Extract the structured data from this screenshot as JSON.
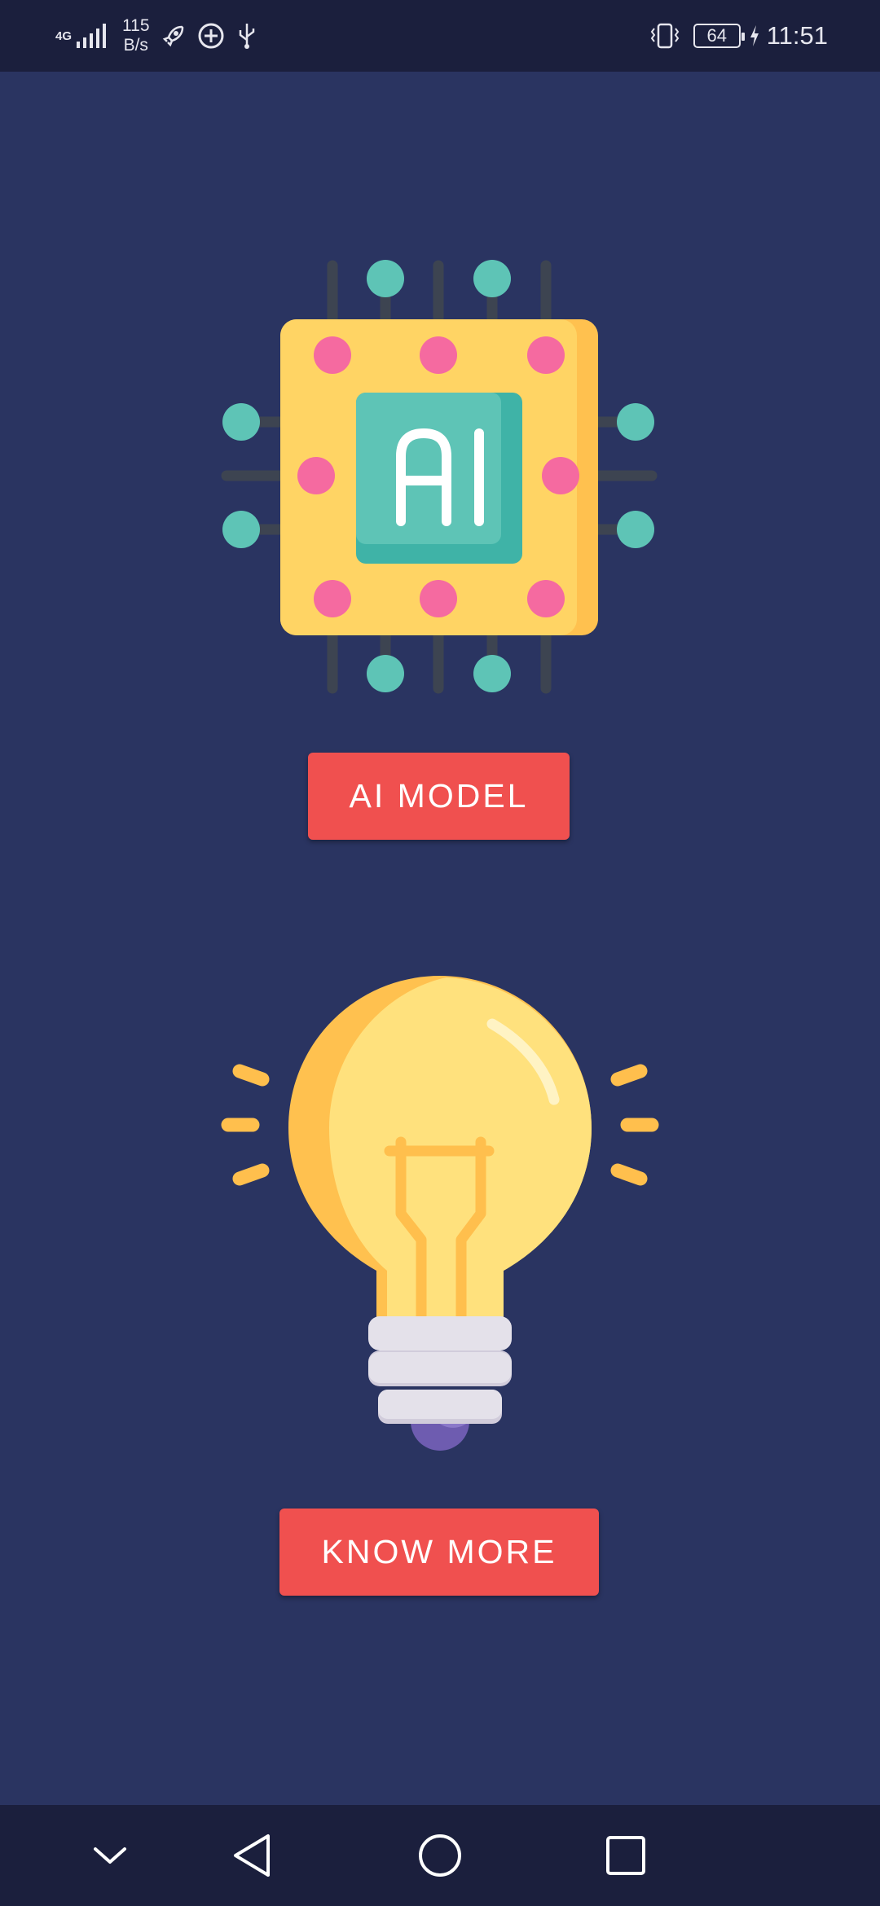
{
  "status_bar": {
    "network_type": "4G",
    "speed_value": "115",
    "speed_unit": "B/s",
    "icons": [
      "signal-icon",
      "rocket-icon",
      "add-circle-icon",
      "usb-icon",
      "vibrate-icon",
      "battery-icon",
      "charging-icon"
    ],
    "battery_level": "64",
    "time": "11:51"
  },
  "main": {
    "ai_model_button_label": "AI MODEL",
    "know_more_button_label": "KNOW MORE",
    "chip_text": "AI",
    "illustrations": [
      "ai-chip-icon",
      "light-bulb-icon"
    ]
  },
  "nav_bar": {
    "icons": [
      "chevron-down-icon",
      "back-icon",
      "home-icon",
      "recents-icon"
    ]
  },
  "colors": {
    "background": "#2a3461",
    "bars": "#1b1f3d",
    "button": "#f0504f",
    "chip_yellow": "#ffd464",
    "chip_teal": "#5ec4b6",
    "chip_pink": "#f56aa0",
    "bulb_yellow": "#ffe17d",
    "bulb_filament": "#ffbf4d",
    "bulb_base_purple": "#8b79c9"
  }
}
